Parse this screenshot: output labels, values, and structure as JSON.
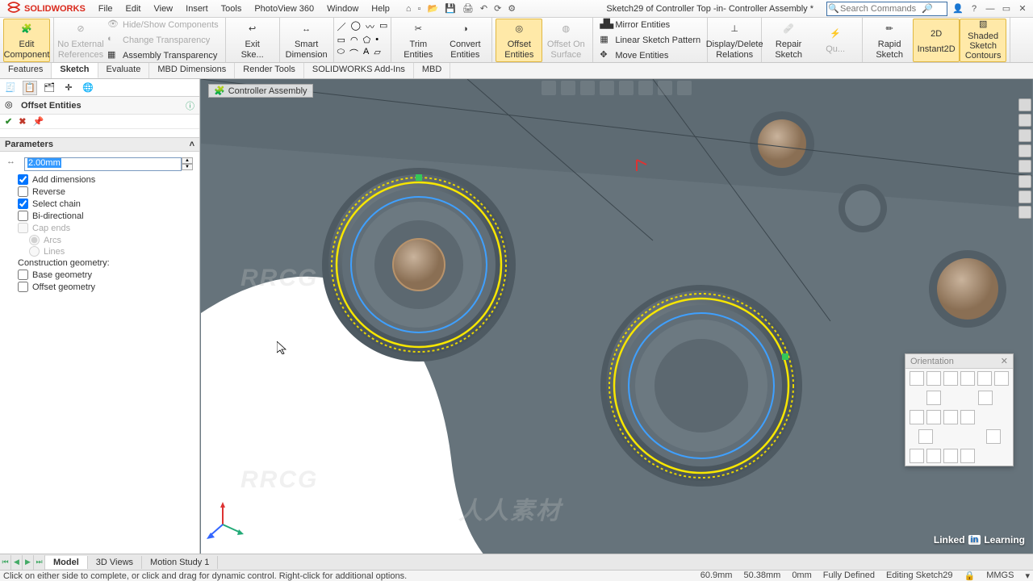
{
  "app": {
    "name": "SOLIDWORKS",
    "doc_title": "Sketch29 of Controller Top -in- Controller Assembly *"
  },
  "menus": [
    "File",
    "Edit",
    "View",
    "Insert",
    "Tools",
    "PhotoView 360",
    "Window",
    "Help"
  ],
  "search": {
    "placeholder": "Search Commands"
  },
  "ribbon": {
    "edit_component": "Edit\nComponent",
    "no_ext_ref": "No External\nReferences",
    "hide_show": "Hide/Show Components",
    "change_trans": "Change Transparency",
    "asm_trans": "Assembly Transparency",
    "exit_sketch": "Exit\nSke...",
    "smart_dim": "Smart Dimension",
    "trim": "Trim Entities",
    "convert": "Convert Entities",
    "offset_ent": "Offset\nEntities",
    "offset_surf": "Offset On\nSurface",
    "mirror": "Mirror Entities",
    "linear_pat": "Linear Sketch Pattern",
    "move": "Move Entities",
    "display_rel": "Display/Delete Relations",
    "repair": "Repair\nSketch",
    "quick": "Qu...",
    "rapid": "Rapid\nSketch",
    "instant2d": "Instant2D",
    "shaded": "Shaded Sketch\nContours"
  },
  "feature_tabs": [
    "Features",
    "Sketch",
    "Evaluate",
    "MBD Dimensions",
    "Render Tools",
    "SOLIDWORKS Add-Ins",
    "MBD"
  ],
  "feature_tab_active_index": 1,
  "pm": {
    "title": "Offset Entities",
    "section": "Parameters",
    "offset_value": "2.00mm",
    "add_dimensions": "Add dimensions",
    "reverse": "Reverse",
    "select_chain": "Select chain",
    "bidirectional": "Bi-directional",
    "cap_ends": "Cap ends",
    "arcs": "Arcs",
    "lines": "Lines",
    "construction_label": "Construction geometry:",
    "base_geom": "Base geometry",
    "offset_geom": "Offset geometry"
  },
  "breadcrumb": "Controller Assembly",
  "orientation_title": "Orientation",
  "bottom_tabs": [
    "Model",
    "3D Views",
    "Motion Study 1"
  ],
  "bottom_active_index": 0,
  "status": {
    "hint": "Click on either side to complete, or click and drag for dynamic control.  Right-click for additional options.",
    "coord1": "60.9mm",
    "coord2": "50.38mm",
    "coord3": "0mm",
    "state": "Fully Defined",
    "context": "Editing Sketch29",
    "units": "MMGS"
  },
  "linkedin": "Linked in Learning",
  "watermark_cn": "人人素材",
  "watermark_en": "RRCG"
}
